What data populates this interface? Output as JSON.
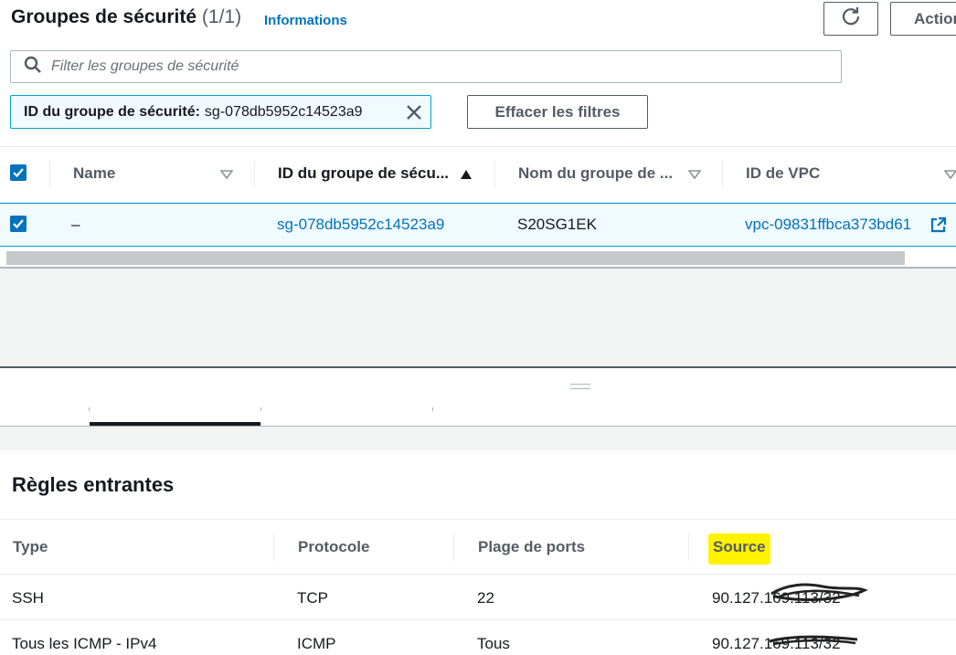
{
  "header": {
    "title": "Groupes de sécurité",
    "count": "(1/1)",
    "info_link": "Informations",
    "actions_label": "Actions"
  },
  "search": {
    "placeholder": "Filter les groupes de sécurité"
  },
  "filter_token": {
    "key": "ID du groupe de sécurité:",
    "value": "sg-078db5952c14523a9"
  },
  "clear_filters_label": "Effacer les filtres",
  "table": {
    "columns": [
      "Name",
      "ID du groupe de sécu...",
      "Nom du groupe de ...",
      "ID de VPC"
    ],
    "rows": [
      {
        "name": "–",
        "group_id": "sg-078db5952c14523a9",
        "group_name": "S20SG1EK",
        "vpc_id": "vpc-09831ffbca373bd61"
      }
    ]
  },
  "inbound": {
    "title": "Règles entrantes",
    "columns": [
      "Type",
      "Protocole",
      "Plage de ports",
      "Source"
    ],
    "rows": [
      {
        "type": "SSH",
        "protocol": "TCP",
        "ports": "22",
        "source": "90.127.169.113/32"
      },
      {
        "type": "Tous les ICMP - IPv4",
        "protocol": "ICMP",
        "ports": "Tous",
        "source": "90.127.169.113/32"
      }
    ]
  },
  "colors": {
    "accent": "#0073bb",
    "selection_border": "#00a1c9",
    "highlight": "#fff200"
  }
}
